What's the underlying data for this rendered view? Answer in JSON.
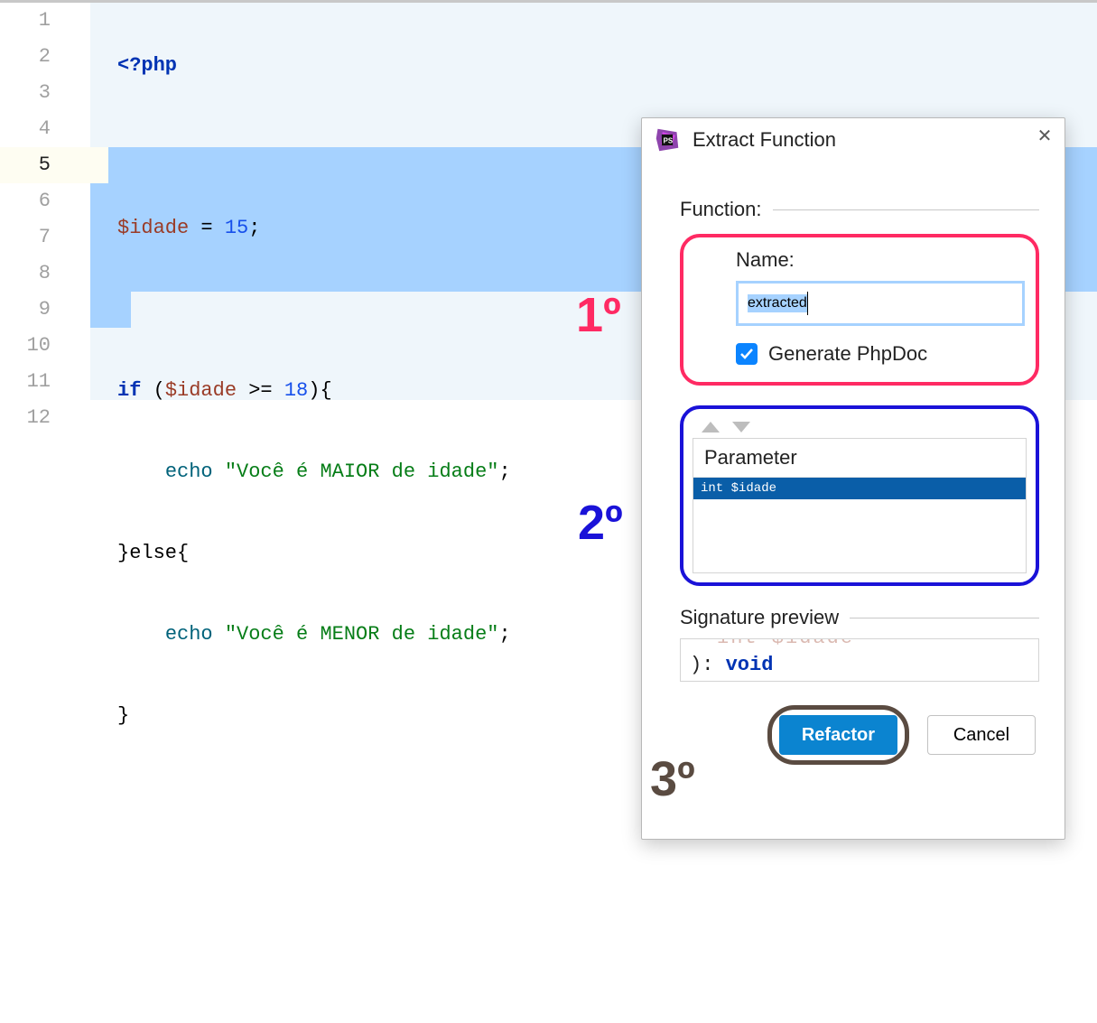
{
  "editor": {
    "lines": [
      {
        "n": "1"
      },
      {
        "n": "2"
      },
      {
        "n": "3"
      },
      {
        "n": "4"
      },
      {
        "n": "5"
      },
      {
        "n": "6"
      },
      {
        "n": "7"
      },
      {
        "n": "8"
      },
      {
        "n": "9"
      },
      {
        "n": "10"
      },
      {
        "n": "11"
      },
      {
        "n": "12"
      }
    ],
    "code": {
      "l1_tag": "<?php",
      "l3_var": "$idade",
      "l3_rest": " = ",
      "l3_num": "15",
      "l3_semi": ";",
      "l5_if": "if ",
      "l5_p1": "(",
      "l5_var": "$idade",
      "l5_op": " >= ",
      "l5_num": "18",
      "l5_p2": "){",
      "l6_indent": "    ",
      "l6_echo": "echo ",
      "l6_str": "\"Você é MAIOR de idade\"",
      "l6_semi": ";",
      "l7": "}else{",
      "l8_indent": "    ",
      "l8_echo": "echo ",
      "l8_str": "\"Você é MENOR de idade\"",
      "l8_semi": ";",
      "l9": "}"
    }
  },
  "dialog": {
    "title": "Extract Function",
    "section_function": "Function:",
    "name_label": "Name:",
    "name_value": "extracted",
    "generate_phpdoc_label": "Generate PhpDoc",
    "generate_phpdoc_checked": true,
    "param_header": "Parameter",
    "param_row": "int $idade",
    "signature_label": "Signature preview",
    "sig_line1": "int $idade",
    "sig_line2_a": "): ",
    "sig_line2_kw1": "void",
    "refactor_btn": "Refactor",
    "cancel_btn": "Cancel"
  },
  "annotations": {
    "a1": "1º",
    "a2": "2º",
    "a3": "3º"
  }
}
